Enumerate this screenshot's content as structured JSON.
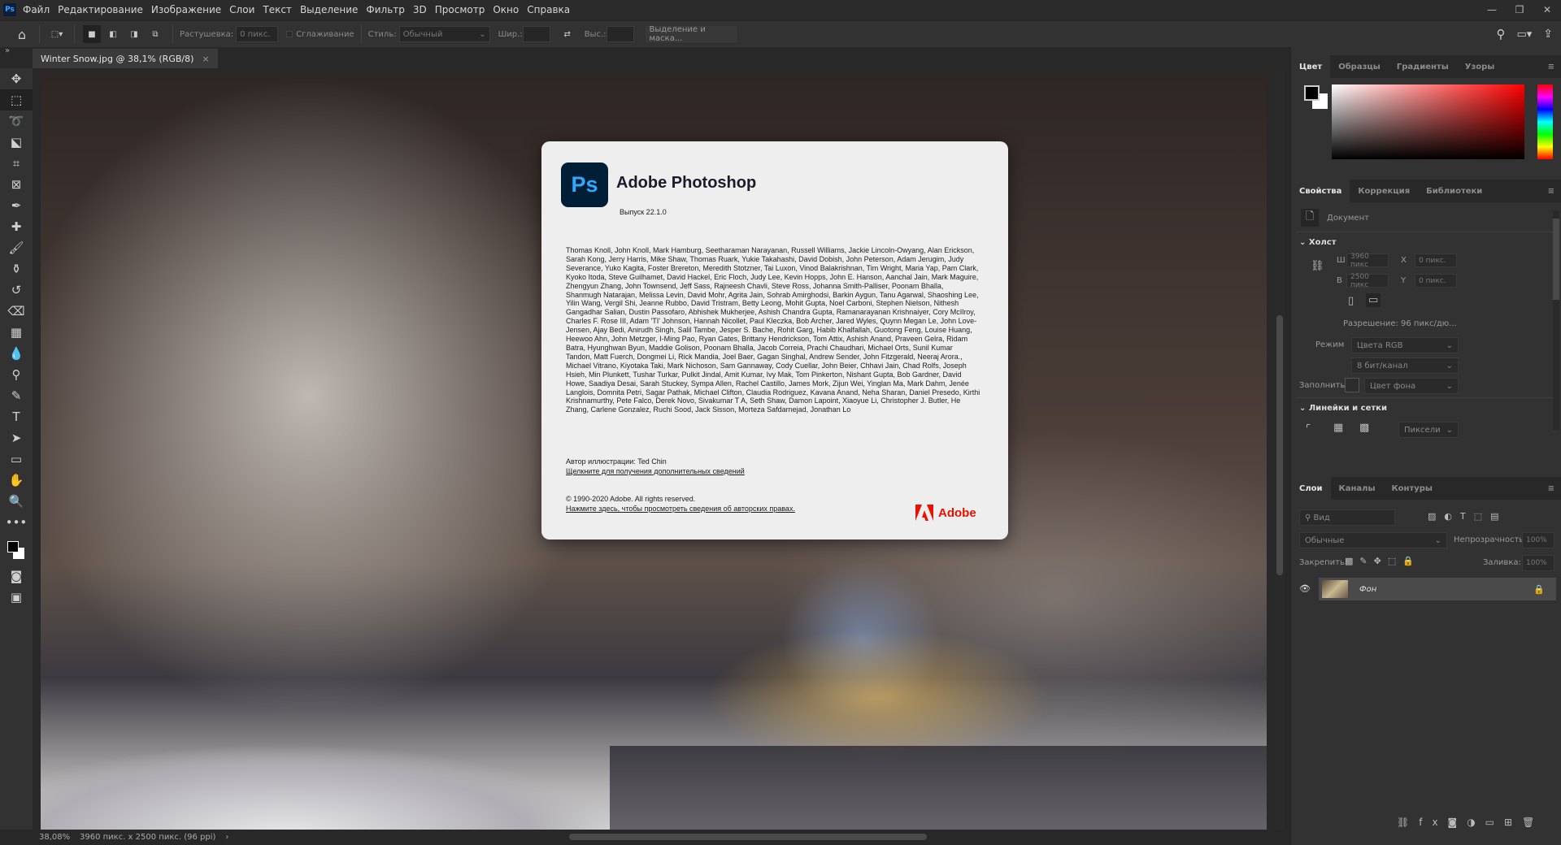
{
  "menubar": {
    "logo": "Ps",
    "items": [
      "Файл",
      "Редактирование",
      "Изображение",
      "Слои",
      "Текст",
      "Выделение",
      "Фильтр",
      "3D",
      "Просмотр",
      "Окно",
      "Справка"
    ]
  },
  "options": {
    "feather_label": "Растушевка:",
    "feather_value": "0 пикс.",
    "antialias_label": "Сглаживание",
    "style_label": "Стиль:",
    "style_value": "Обычный",
    "width_label": "Шир.:",
    "height_label": "Выс.:",
    "select_mask": "Выделение и маска..."
  },
  "document_tab": {
    "title": "Winter Snow.jpg @ 38,1% (RGB/8)",
    "close": "×"
  },
  "status": {
    "zoom": "38,08%",
    "doc_info": "3960 пикс. x 2500 пикс. (96 ppi)",
    "arrow": "›"
  },
  "about": {
    "logo": "Ps",
    "title": "Adobe Photoshop",
    "version": "Выпуск 22.1.0",
    "credits": "Thomas Knoll, John Knoll, Mark Hamburg, Seetharaman Narayanan, Russell Williams, Jackie Lincoln-Owyang, Alan Erickson, Sarah Kong, Jerry Harris, Mike Shaw, Thomas Ruark, Yukie Takahashi, David Dobish, John Peterson, Adam Jerugim, Judy Severance, Yuko Kagita, Foster Brereton, Meredith Stotzner, Tai Luxon, Vinod Balakrishnan, Tim Wright, Maria Yap, Pam Clark, Kyoko Itoda, Steve Guilhamet, David Hackel, Eric Floch, Judy Lee, Kevin Hopps, John E. Hanson, Aanchal Jain, Mark Maguire, Zhengyun Zhang, John Townsend, Jeff Sass, Rajneesh Chavli, Steve Ross, Johanna Smith-Palliser, Poonam Bhalla, Shanmugh Natarajan, Melissa Levin, David Mohr, Agrita Jain, Sohrab Amirghodsi, Barkin Aygun, Tanu Agarwal, Shaoshing Lee, Yilin Wang, Vergil Shi, Jeanne Rubbo, David Tristram, Betty Leong, Mohit Gupta, Noel Carboni, Stephen Nielson, Nithesh Gangadhar Salian, Dustin Passofaro, Abhishek Mukherjee, Ashish Chandra Gupta, Ramanarayanan Krishnaiyer, Cory McIlroy, Charles F. Rose III, Adam 'TI' Johnson, Hannah Nicollet, Paul Kleczka, Bob Archer, Jared Wyles, Quynn Megan Le, John Love-Jensen, Ajay Bedi, Anirudh Singh, Salil Tambe, Jesper S. Bache, Rohit Garg, Habib Khalfallah, Guotong Feng, Louise Huang, Heewoo Ahn, John Metzger, I-Ming Pao, Ryan Gates, Brittany Hendrickson, Tom Attix, Ashish Anand, Praveen Gelra, Ridam Batra, Hyunghwan Byun, Maddie Golison, Poonam Bhalla, Jacob Correia, Prachi Chaudhari, Michael Orts, Sunil Kumar Tandon, Matt Fuerch, Dongmei Li, Rick Mandia, Joel Baer, Gagan Singhal, Andrew Sender, John Fitzgerald, Neeraj Arora., Michael Vitrano, Kiyotaka Taki, Mark Nichoson, Sam Gannaway, Cody Cuellar, John Beier, Chhavi Jain, Chad Rolfs, Joseph Hsieh, Min Plunkett, Tushar Turkar, Pulkit Jindal, Amit Kumar, Ivy Mak, Tom Pinkerton, Nishant Gupta, Bob Gardner, David Howe, Saadiya Desai, Sarah Stuckey, Sympa Allen, Rachel Castillo, James Mork, Zijun Wei, Yinglan Ma, Mark Dahm, Jenée Langlois, Domnita Petri, Sagar Pathak, Michael Clifton, Claudia Rodriguez, Kavana Anand, Neha Sharan, Daniel Presedo, Kirthi Krishnamurthy, Pete Falco, Derek Novo, Sivakumar T A, Seth Shaw, Damon Lapoint, Xiaoyue Li, Christopher J. Butler, He Zhang, Carlene Gonzalez, Ruchi Sood, Jack Sisson, Morteza Safdarnejad, Jonathan Lo",
    "illustration": "Автор иллюстрации: Ted Chin",
    "more_info_link": "Щелкните для получения дополнительных сведений",
    "copyright": "© 1990-2020 Adobe. All rights reserved.",
    "legal_link": "Нажмите здесь, чтобы просмотреть сведения об авторских правах.",
    "brand": "Adobe"
  },
  "color_panel": {
    "tabs": [
      "Цвет",
      "Образцы",
      "Градиенты",
      "Узоры"
    ],
    "foreground": "#000000",
    "background": "#ffffff"
  },
  "properties": {
    "tabs": [
      "Свойства",
      "Коррекция",
      "Библиотеки"
    ],
    "doc_label": "Документ",
    "canvas_section": "Холст",
    "w_label": "Ш",
    "w_value": "3960 пикс",
    "h_label": "В",
    "h_value": "2500 пикс",
    "x_label": "X",
    "x_value": "0 пикс.",
    "y_label": "Y",
    "y_value": "0 пикс.",
    "resolution": "Разрешение: 96 пикс/дю...",
    "mode_label": "Режим",
    "mode_value": "Цвета RGB",
    "depth_value": "8 бит/канал",
    "fill_label": "Заполнить",
    "fill_value": "Цвет фона",
    "rulers_section": "Линейки и сетки",
    "units_value": "Пиксели"
  },
  "layers": {
    "tabs": [
      "Слои",
      "Каналы",
      "Контуры"
    ],
    "filter_placeholder": "Вид",
    "blend_mode": "Обычные",
    "opacity_label": "Непрозрачность:",
    "opacity_value": "100%",
    "lock_label": "Закрепить:",
    "fill_label": "Заливка:",
    "fill_value": "100%",
    "items": [
      {
        "name": "Фон",
        "visible": true,
        "locked": true
      }
    ]
  }
}
